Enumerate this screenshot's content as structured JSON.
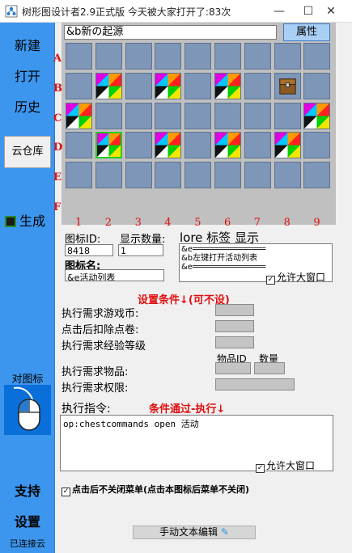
{
  "window": {
    "title": "树形图设计者2.9正式版  今天被大家打开了:83次",
    "minimize_glyph": "—",
    "maximize_glyph": "☐",
    "close_glyph": "✕"
  },
  "sidebar": {
    "new_label": "新建",
    "open_label": "打开",
    "history_label": "历史",
    "cloud_label": "云仓库",
    "generate_label": "生成",
    "icon_section_label": "对图标",
    "support_label": "支持",
    "settings_label": "设置",
    "status_label": "已连接云"
  },
  "editor": {
    "menu_name": "&b新の起源",
    "attributes_tab": "属性",
    "row_labels": [
      "A",
      "B",
      "C",
      "D",
      "E",
      "F"
    ],
    "col_labels": [
      "1",
      "2",
      "3",
      "4",
      "5",
      "6",
      "7",
      "8",
      "9"
    ]
  },
  "icon_props": {
    "icon_id_label": "图标ID:",
    "icon_id_value": "8418",
    "amount_label": "显示数量:",
    "amount_value": "1",
    "lore_label": "lore 标签 显示",
    "lore_lines": [
      "&e═══════════════",
      "&b左键打开活动列表",
      "&e═══════════════"
    ],
    "allow_large_window": "允许大窗口",
    "icon_name_label": "图标名:",
    "icon_name_value": "&e活动列表"
  },
  "conditions": {
    "title": "设置条件↓(可不设)",
    "game_money_label": "执行需求游戏币:",
    "points_label": "点击后扣除点卷:",
    "exp_label": "执行需求经验等级",
    "items_label": "执行需求物品:",
    "item_id_header": "物品ID",
    "quantity_header": "数量",
    "permission_label": "执行需求权限:"
  },
  "commands": {
    "label": "执行指令:",
    "pass_title": "条件通过-执行↓",
    "value": "op:chestcommands open 活动",
    "allow_large_window": "允许大窗口",
    "keep_open_label": "点击后不关闭菜单(点击本图标后菜单不关闭)"
  },
  "footer": {
    "manual_edit_label": "手动文本编辑"
  }
}
